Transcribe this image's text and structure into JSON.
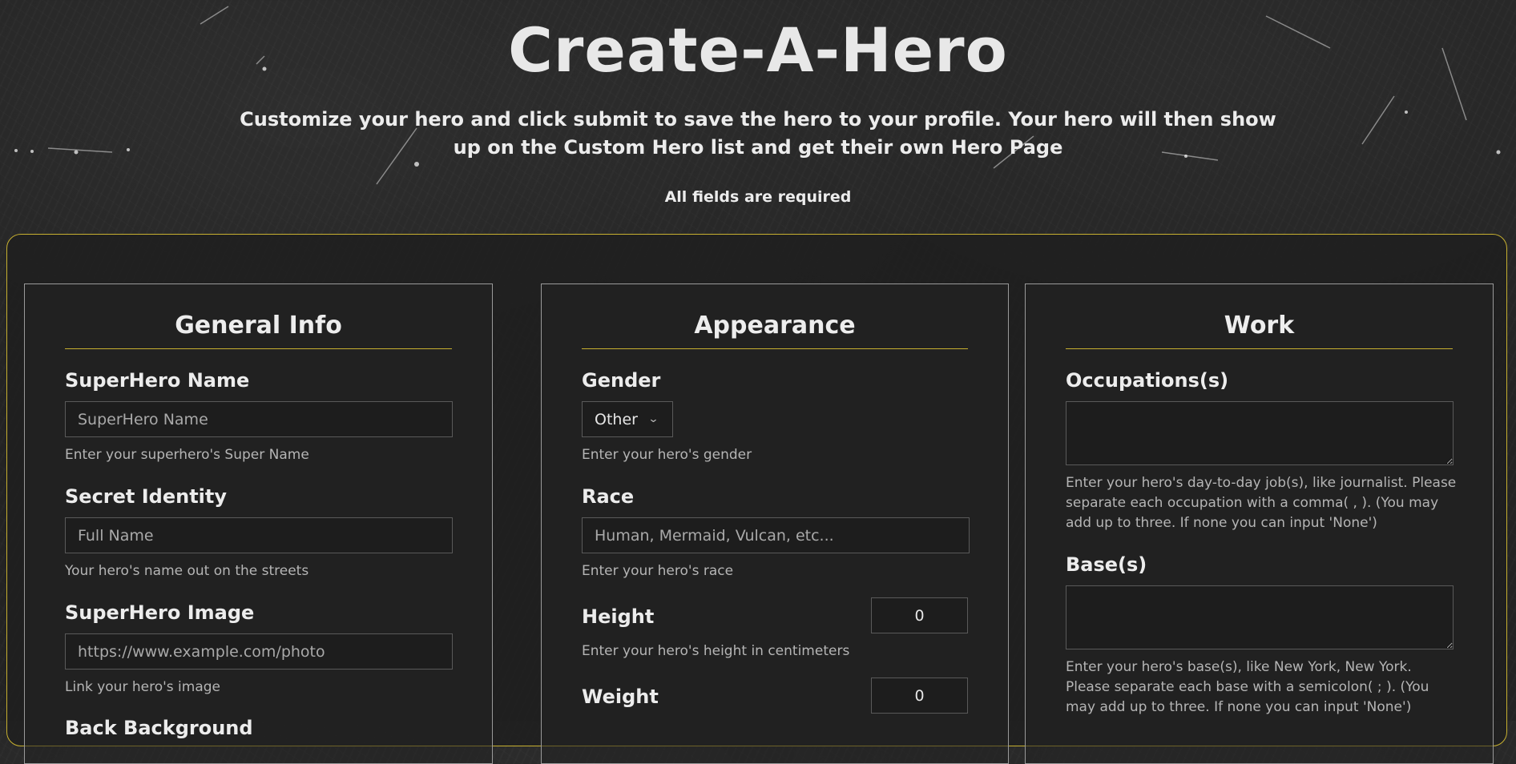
{
  "header": {
    "title": "Create-A-Hero",
    "intro": "Customize your hero and click submit to save the hero to your profile. Your hero will then show up on the Custom Hero list and get their own Hero Page",
    "required_note": "All fields are required"
  },
  "colors": {
    "accent": "#c7b030",
    "background": "#232323"
  },
  "general": {
    "title": "General Info",
    "superhero_name": {
      "label": "SuperHero Name",
      "placeholder": "SuperHero Name",
      "help": "Enter your superhero's Super Name"
    },
    "secret_identity": {
      "label": "Secret Identity",
      "placeholder": "Full Name",
      "help": "Your hero's name out on the streets"
    },
    "superhero_image": {
      "label": "SuperHero Image",
      "placeholder": "https://www.example.com/photo",
      "help": "Link your hero's image"
    },
    "next_label": "Back Background"
  },
  "appearance": {
    "title": "Appearance",
    "gender": {
      "label": "Gender",
      "value": "Other",
      "help": "Enter your hero's gender",
      "icon": "chevron-down-icon"
    },
    "race": {
      "label": "Race",
      "placeholder": "Human, Mermaid, Vulcan, etc...",
      "help": "Enter your hero's race"
    },
    "height": {
      "label": "Height",
      "value": "0",
      "help": "Enter your hero's height in centimeters"
    },
    "weight": {
      "label": "Weight",
      "value": "0"
    }
  },
  "work": {
    "title": "Work",
    "occupations": {
      "label": "Occupations(s)",
      "help": "Enter your hero's day-to-day job(s), like journalist. Please separate each occupation with a comma( , ). (You may add up to three. If none you can input 'None')"
    },
    "bases": {
      "label": "Base(s)",
      "help": "Enter your hero's base(s), like New York, New York. Please separate each base with a semicolon( ; ). (You may add up to three. If none you can input 'None')"
    }
  }
}
